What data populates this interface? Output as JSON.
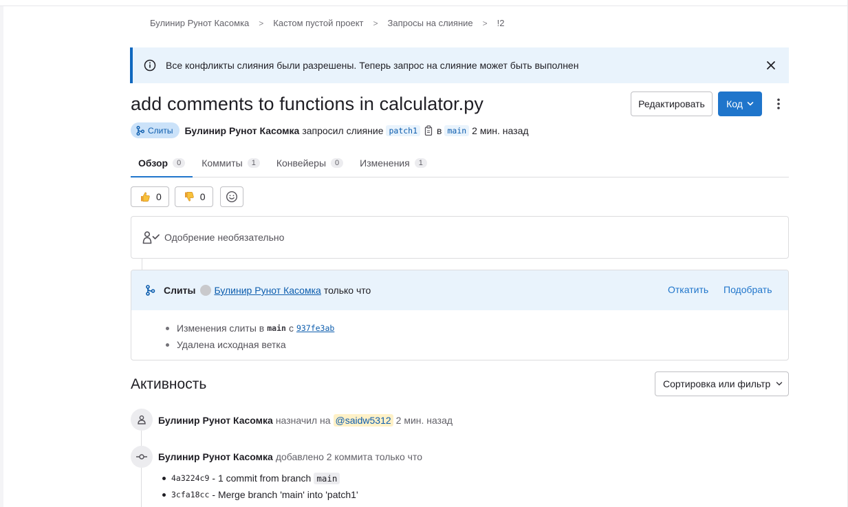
{
  "breadcrumb": {
    "items": [
      "Булинир Рунот Касомка",
      "Кастом пустой проект",
      "Запросы на слияние",
      "!2"
    ]
  },
  "alert": {
    "text": "Все конфликты слияния были разрешены. Теперь запрос на слияние может быть выполнен"
  },
  "header": {
    "title": "add comments to functions in calculator.py",
    "edit_label": "Редактировать",
    "code_label": "Код"
  },
  "meta": {
    "status": "Слиты",
    "author": "Булинир Рунот Касомка",
    "verb": "запросил слияние",
    "source_branch": "patch1",
    "in": "в",
    "target_branch": "main",
    "time": "2 мин. назад"
  },
  "tabs": [
    {
      "label": "Обзор",
      "count": "0"
    },
    {
      "label": "Коммиты",
      "count": "1"
    },
    {
      "label": "Конвейеры",
      "count": "0"
    },
    {
      "label": "Изменения",
      "count": "1"
    }
  ],
  "reactions": {
    "thumbs_up": "0",
    "thumbs_down": "0"
  },
  "approval": {
    "text": "Одобрение необязательно"
  },
  "merged": {
    "label": "Слиты",
    "user": "Булинир Рунот Касомка",
    "when": "только что",
    "revert": "Откатить",
    "cherry_pick": "Подобрать",
    "line1_prefix": "Изменения слиты в",
    "line1_branch": "main",
    "line1_mid": "с",
    "line1_sha": "937fe3ab",
    "line2": "Удалена исходная ветка"
  },
  "activity": {
    "title": "Активность",
    "sort_label": "Сортировка или фильтр",
    "events": [
      {
        "who": "Булинир Рунот Касомка",
        "text": "назначил на",
        "mention": "@saidw5312",
        "time": "2 мин. назад"
      },
      {
        "who": "Булинир Рунот Касомка",
        "text": "добавлено 2 коммита только что"
      }
    ],
    "commits": [
      {
        "sha": "4a3224c9",
        "msg": "- 1 commit from branch",
        "branch": "main"
      },
      {
        "sha": "3cfa18cc",
        "msg": "- Merge branch 'main' into 'patch1'"
      }
    ]
  }
}
